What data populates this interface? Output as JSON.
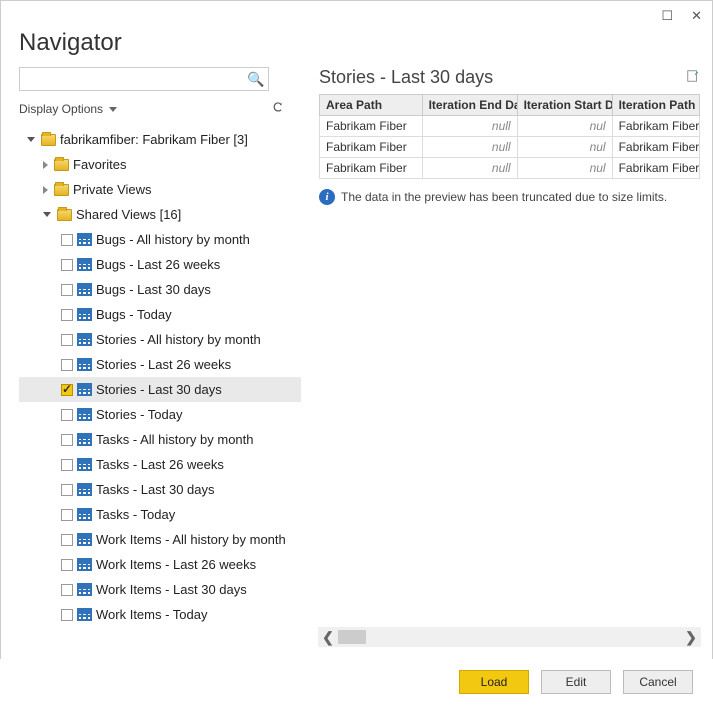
{
  "window": {
    "title": "Navigator",
    "maximize_glyph": "☐",
    "close_glyph": "✕"
  },
  "search": {
    "placeholder": "",
    "value": "",
    "icon": "🔍"
  },
  "display_options_label": "Display Options",
  "tree": {
    "root": {
      "label": "fabrikamfiber: Fabrikam Fiber [3]"
    },
    "favorites": {
      "label": "Favorites"
    },
    "private_views": {
      "label": "Private Views"
    },
    "shared_views": {
      "label": "Shared Views [16]"
    },
    "views": [
      {
        "label": "Bugs - All history by month",
        "checked": false
      },
      {
        "label": "Bugs - Last 26 weeks",
        "checked": false
      },
      {
        "label": "Bugs - Last 30 days",
        "checked": false
      },
      {
        "label": "Bugs - Today",
        "checked": false
      },
      {
        "label": "Stories - All history by month",
        "checked": false
      },
      {
        "label": "Stories - Last 26 weeks",
        "checked": false
      },
      {
        "label": "Stories - Last 30 days",
        "checked": true
      },
      {
        "label": "Stories - Today",
        "checked": false
      },
      {
        "label": "Tasks - All history by month",
        "checked": false
      },
      {
        "label": "Tasks - Last 26 weeks",
        "checked": false
      },
      {
        "label": "Tasks - Last 30 days",
        "checked": false
      },
      {
        "label": "Tasks - Today",
        "checked": false
      },
      {
        "label": "Work Items - All history by month",
        "checked": false
      },
      {
        "label": "Work Items - Last 26 weeks",
        "checked": false
      },
      {
        "label": "Work Items - Last 30 days",
        "checked": false
      },
      {
        "label": "Work Items - Today",
        "checked": false
      }
    ]
  },
  "preview": {
    "title": "Stories - Last 30 days",
    "columns": [
      "Area Path",
      "Iteration End Date",
      "Iteration Start Date",
      "Iteration Path"
    ],
    "rows": [
      {
        "c0": "Fabrikam Fiber",
        "c1": "null",
        "c2": "nul",
        "c3": "Fabrikam Fiber"
      },
      {
        "c0": "Fabrikam Fiber",
        "c1": "null",
        "c2": "nul",
        "c3": "Fabrikam Fiber"
      },
      {
        "c0": "Fabrikam Fiber",
        "c1": "null",
        "c2": "nul",
        "c3": "Fabrikam Fiber"
      }
    ],
    "info": "The data in the preview has been truncated due to size limits."
  },
  "scroll": {
    "left_glyph": "❮",
    "right_glyph": "❯"
  },
  "buttons": {
    "load": "Load",
    "edit": "Edit",
    "cancel": "Cancel"
  }
}
